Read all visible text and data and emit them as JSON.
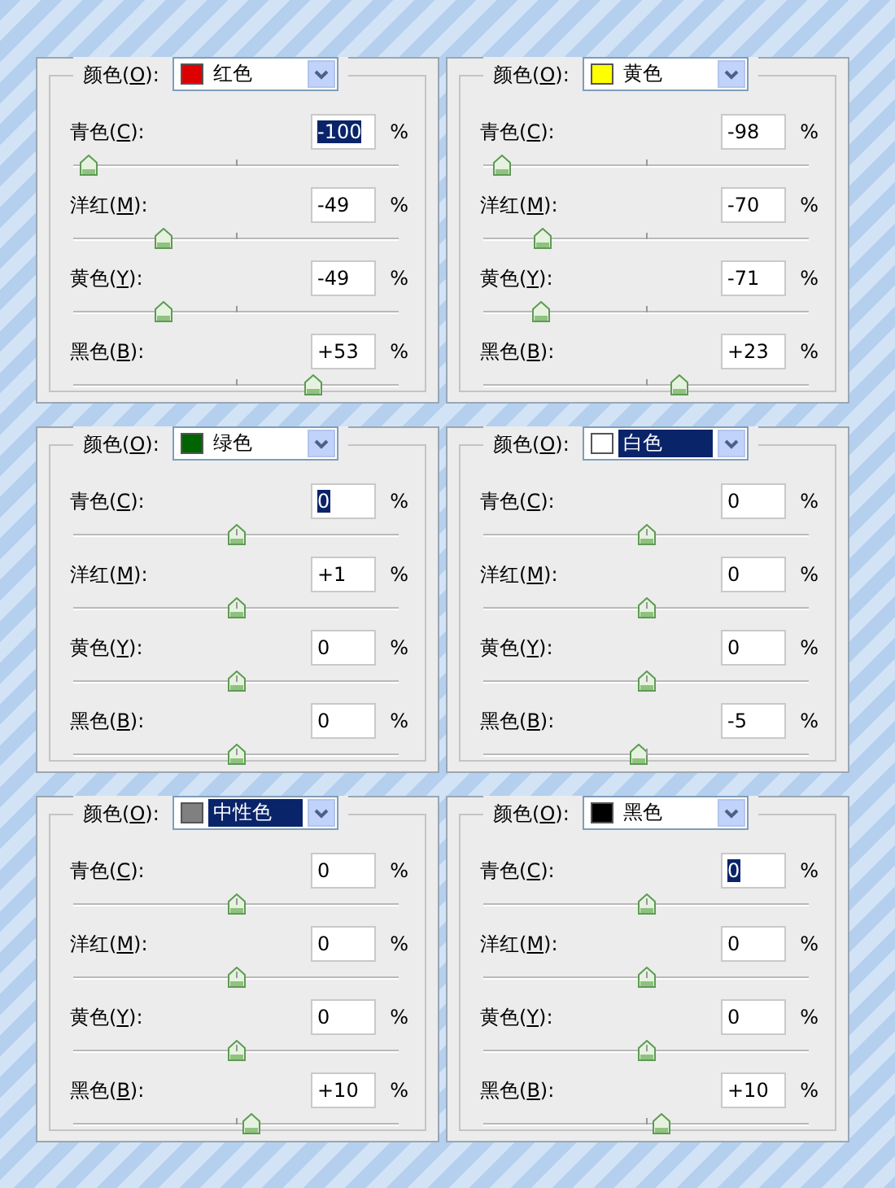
{
  "panels": [
    {
      "color_menu": {
        "label_before": "颜色(",
        "key": "O",
        "label_after": "):",
        "value": "红色",
        "color": "#dd0000",
        "selected": false
      },
      "sliders": [
        {
          "label_before": "青色(",
          "key": "C",
          "label_after": "):",
          "value": "-100",
          "value_selected": true,
          "unit": "%",
          "level": 0
        },
        {
          "label_before": "洋红(",
          "key": "M",
          "label_after": "):",
          "value": "-49",
          "value_selected": false,
          "unit": "%",
          "level": 0.255
        },
        {
          "label_before": "黄色(",
          "key": "Y",
          "label_after": "):",
          "value": "-49",
          "value_selected": false,
          "unit": "%",
          "level": 0.255
        },
        {
          "label_before": "黑色(",
          "key": "B",
          "label_after": "):",
          "value": "+53",
          "value_selected": false,
          "unit": "%",
          "level": 0.765
        }
      ]
    },
    {
      "color_menu": {
        "label_before": "颜色(",
        "key": "O",
        "label_after": "):",
        "value": "黄色",
        "color": "#ffff00",
        "selected": false
      },
      "sliders": [
        {
          "label_before": "青色(",
          "key": "C",
          "label_after": "):",
          "value": "-98",
          "value_selected": false,
          "unit": "%",
          "level": 0.01
        },
        {
          "label_before": "洋红(",
          "key": "M",
          "label_after": "):",
          "value": "-70",
          "value_selected": false,
          "unit": "%",
          "level": 0.15
        },
        {
          "label_before": "黄色(",
          "key": "Y",
          "label_after": "):",
          "value": "-71",
          "value_selected": false,
          "unit": "%",
          "level": 0.145
        },
        {
          "label_before": "黑色(",
          "key": "B",
          "label_after": "):",
          "value": "+23",
          "value_selected": false,
          "unit": "%",
          "level": 0.615
        }
      ]
    },
    {
      "color_menu": {
        "label_before": "颜色(",
        "key": "O",
        "label_after": "):",
        "value": "绿色",
        "color": "#006400",
        "selected": false
      },
      "sliders": [
        {
          "label_before": "青色(",
          "key": "C",
          "label_after": "):",
          "value": "0",
          "value_selected": true,
          "unit": "%",
          "level": 0.5
        },
        {
          "label_before": "洋红(",
          "key": "M",
          "label_after": "):",
          "value": "+1",
          "value_selected": false,
          "unit": "%",
          "level": 0.505
        },
        {
          "label_before": "黄色(",
          "key": "Y",
          "label_after": "):",
          "value": "0",
          "value_selected": false,
          "unit": "%",
          "level": 0.5
        },
        {
          "label_before": "黑色(",
          "key": "B",
          "label_after": "):",
          "value": "0",
          "value_selected": false,
          "unit": "%",
          "level": 0.5
        }
      ]
    },
    {
      "color_menu": {
        "label_before": "颜色(",
        "key": "O",
        "label_after": "):",
        "value": "白色",
        "color": "#ffffff",
        "selected": true
      },
      "sliders": [
        {
          "label_before": "青色(",
          "key": "C",
          "label_after": "):",
          "value": "0",
          "value_selected": false,
          "unit": "%",
          "level": 0.5
        },
        {
          "label_before": "洋红(",
          "key": "M",
          "label_after": "):",
          "value": "0",
          "value_selected": false,
          "unit": "%",
          "level": 0.5
        },
        {
          "label_before": "黄色(",
          "key": "Y",
          "label_after": "):",
          "value": "0",
          "value_selected": false,
          "unit": "%",
          "level": 0.5
        },
        {
          "label_before": "黑色(",
          "key": "B",
          "label_after": "):",
          "value": "-5",
          "value_selected": false,
          "unit": "%",
          "level": 0.475
        }
      ]
    },
    {
      "color_menu": {
        "label_before": "颜色(",
        "key": "O",
        "label_after": "):",
        "value": "中性色",
        "color": "#808080",
        "selected": true
      },
      "sliders": [
        {
          "label_before": "青色(",
          "key": "C",
          "label_after": "):",
          "value": "0",
          "value_selected": false,
          "unit": "%",
          "level": 0.5
        },
        {
          "label_before": "洋红(",
          "key": "M",
          "label_after": "):",
          "value": "0",
          "value_selected": false,
          "unit": "%",
          "level": 0.5
        },
        {
          "label_before": "黄色(",
          "key": "Y",
          "label_after": "):",
          "value": "0",
          "value_selected": false,
          "unit": "%",
          "level": 0.5
        },
        {
          "label_before": "黑色(",
          "key": "B",
          "label_after": "):",
          "value": "+10",
          "value_selected": false,
          "unit": "%",
          "level": 0.55
        }
      ]
    },
    {
      "color_menu": {
        "label_before": "颜色(",
        "key": "O",
        "label_after": "):",
        "value": "黑色",
        "color": "#000000",
        "selected": false
      },
      "sliders": [
        {
          "label_before": "青色(",
          "key": "C",
          "label_after": "):",
          "value": "0",
          "value_selected": true,
          "unit": "%",
          "level": 0.5
        },
        {
          "label_before": "洋红(",
          "key": "M",
          "label_after": "):",
          "value": "0",
          "value_selected": false,
          "unit": "%",
          "level": 0.5
        },
        {
          "label_before": "黄色(",
          "key": "Y",
          "label_after": "):",
          "value": "0",
          "value_selected": false,
          "unit": "%",
          "level": 0.5
        },
        {
          "label_before": "黑色(",
          "key": "B",
          "label_after": "):",
          "value": "+10",
          "value_selected": false,
          "unit": "%",
          "level": 0.55
        }
      ]
    }
  ]
}
